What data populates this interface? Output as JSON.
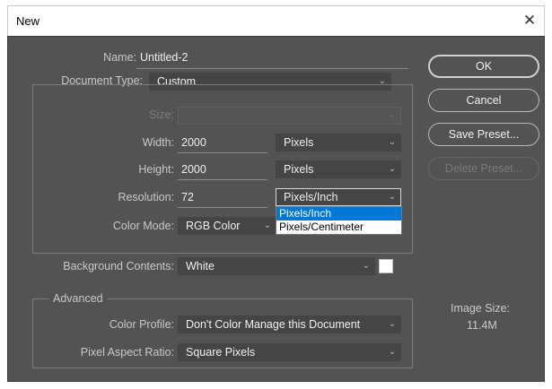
{
  "window": {
    "title": "New",
    "close_glyph": "✕"
  },
  "form": {
    "name": {
      "label": "Name:",
      "value": "Untitled-2"
    },
    "document_type": {
      "label": "Document Type:",
      "value": "Custom"
    },
    "size": {
      "label": "Size:",
      "value": ""
    },
    "width": {
      "label": "Width:",
      "value": "2000",
      "unit": "Pixels"
    },
    "height": {
      "label": "Height:",
      "value": "2000",
      "unit": "Pixels"
    },
    "resolution": {
      "label": "Resolution:",
      "value": "72",
      "unit": "Pixels/Inch"
    },
    "color_mode": {
      "label": "Color Mode:",
      "value": "RGB Color"
    },
    "background_contents": {
      "label": "Background Contents:",
      "value": "White",
      "swatch_color": "#ffffff"
    }
  },
  "resolution_menu": {
    "options": [
      "Pixels/Inch",
      "Pixels/Centimeter"
    ],
    "selected_index": 0
  },
  "advanced": {
    "title": "Advanced",
    "color_profile": {
      "label": "Color Profile:",
      "value": "Don't Color Manage this Document"
    },
    "pixel_aspect_ratio": {
      "label": "Pixel Aspect Ratio:",
      "value": "Square Pixels"
    }
  },
  "buttons": {
    "ok": "OK",
    "cancel": "Cancel",
    "save_preset": "Save Preset...",
    "delete_preset": "Delete Preset..."
  },
  "image_size": {
    "label": "Image Size:",
    "value": "11.4M"
  },
  "icons": {
    "dropdown_chevron": "chevron-down-icon",
    "close": "close-icon"
  },
  "colors": {
    "dialog_bg": "#535353",
    "field_bg": "#454545",
    "selection": "#0078d7"
  }
}
